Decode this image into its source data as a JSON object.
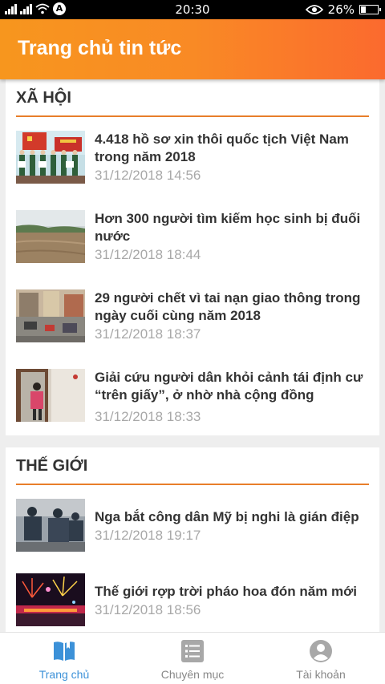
{
  "status_bar": {
    "time": "20:30",
    "battery": "26%"
  },
  "header": {
    "title": "Trang chủ tin tức"
  },
  "sections": [
    {
      "name": "XÃ HỘI",
      "articles": [
        {
          "title": "4.418 hồ sơ xin thôi quốc tịch Việt Nam trong năm 2018",
          "date": "31/12/2018 14:56"
        },
        {
          "title": "Hơn 300 người tìm kiếm học sinh bị đuối nước",
          "date": "31/12/2018 18:44"
        },
        {
          "title": "29 người chết vì tai nạn giao thông trong ngày cuối cùng năm 2018",
          "date": "31/12/2018 18:37"
        },
        {
          "title": "Giải cứu người dân khỏi cảnh tái định cư “trên giấy”, ở nhờ nhà cộng đồng",
          "date": "31/12/2018 18:33"
        }
      ]
    },
    {
      "name": "THẾ GIỚI",
      "articles": [
        {
          "title": "Nga bắt công dân Mỹ bị nghi là gián điệp",
          "date": "31/12/2018 19:17"
        },
        {
          "title": "Thế giới rợp trời pháo hoa đón năm mới",
          "date": "31/12/2018 18:56"
        }
      ]
    }
  ],
  "bottom_nav": {
    "items": [
      {
        "label": "Trang chủ",
        "icon": "book-icon",
        "active": true
      },
      {
        "label": "Chuyên mục",
        "icon": "list-icon",
        "active": false
      },
      {
        "label": "Tài khoản",
        "icon": "account-icon",
        "active": false
      }
    ]
  },
  "colors": {
    "accent": "#f98a25",
    "section_rule": "#e87e2a",
    "nav_active": "#3c91d8",
    "date_text": "#a8a8a8"
  }
}
